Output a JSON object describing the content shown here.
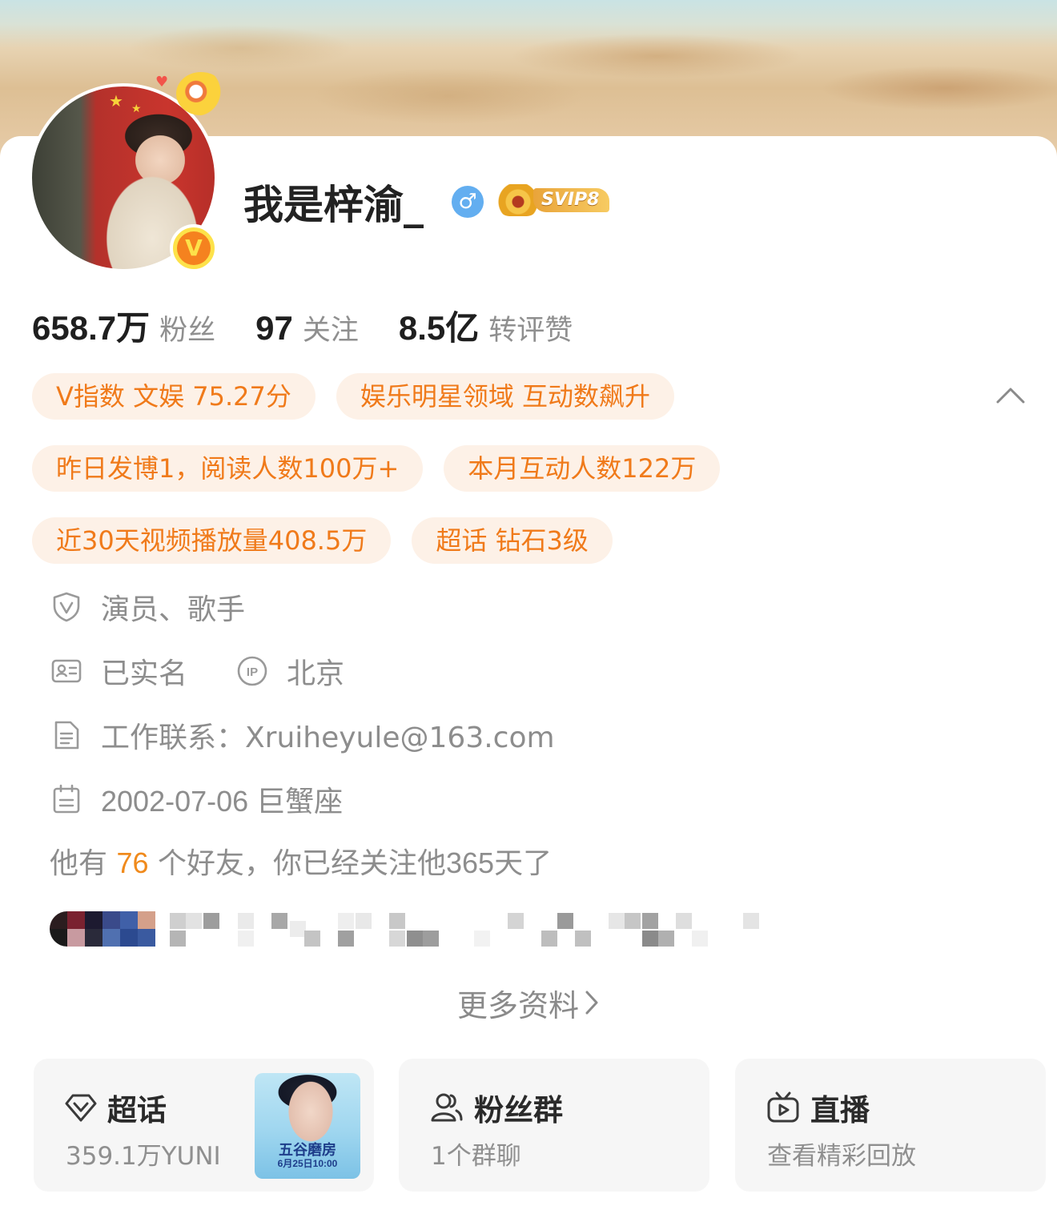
{
  "profile": {
    "name": "我是梓渝_",
    "gender_symbol": "♂",
    "vip_badge": "SVIP8",
    "verified_badge": "V"
  },
  "stats": [
    {
      "value": "658.7万",
      "label": "粉丝"
    },
    {
      "value": "97",
      "label": "关注"
    },
    {
      "value": "8.5亿",
      "label": "转评赞"
    }
  ],
  "tags": [
    [
      "V指数 文娱 75.27分",
      "娱乐明星领域 互动数飙升"
    ],
    [
      "昨日发博1，阅读人数100万+",
      "本月互动人数122万"
    ],
    [
      "近30天视频播放量408.5万",
      "超话 钻石3级"
    ]
  ],
  "info": {
    "occupation": "演员、歌手",
    "real_name": "已实名",
    "ip_location": "北京",
    "work_contact": "工作联系：Xruiheyule@163.com",
    "birthday": "2002-07-06 巨蟹座"
  },
  "friends": {
    "prefix": "他有",
    "count": "76",
    "middle": "个好友，你已经关注他",
    "days": "365",
    "suffix": "天了"
  },
  "more_info": "更多资料",
  "cards": {
    "super_topic": {
      "title": "超话",
      "subtitle": "359.1万YUNI",
      "poster_title": "五谷磨房",
      "poster_date": "6月25日10:00"
    },
    "fan_group": {
      "title": "粉丝群",
      "subtitle": "1个群聊"
    },
    "live": {
      "title": "直播",
      "subtitle": "查看精彩回放"
    }
  },
  "colors": {
    "accent_orange": "#f07a1a",
    "tag_bg": "#fdf1e7",
    "gray_text": "#8d8d8d",
    "verified_orange": "#f5821f",
    "gender_blue": "#63aef0"
  }
}
